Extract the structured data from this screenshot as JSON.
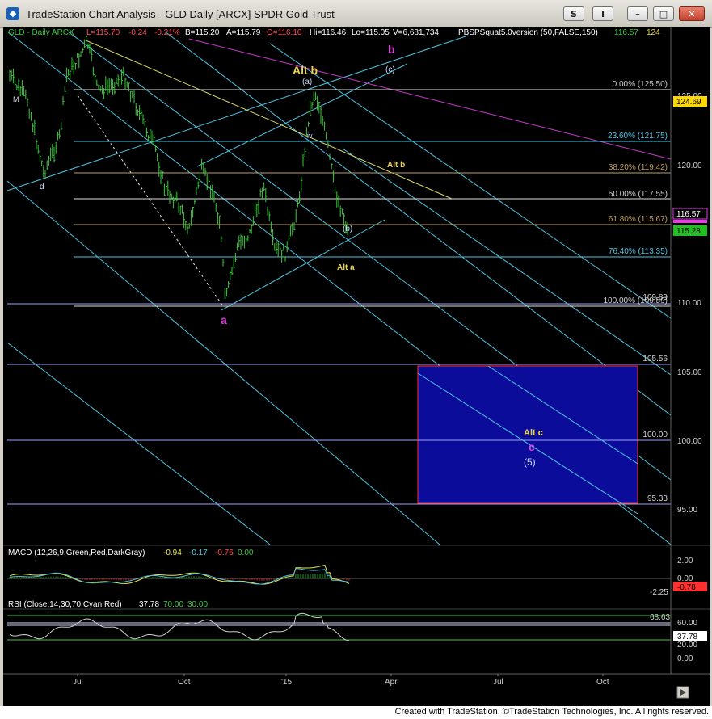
{
  "window": {
    "title": "TradeStation Chart Analysis - GLD Daily [ARCX] SPDR Gold Trust",
    "buttons": {
      "s": "S",
      "i": "I",
      "min": "–",
      "max": "□",
      "close": "✕"
    }
  },
  "header": {
    "symbol": "GLD - Daily  ARCX",
    "last": "L=115.70",
    "change": "-0.24",
    "change_pct": "-0.21%",
    "bid": "B=115.20",
    "ask": "A=115.79",
    "open": "O=116.10",
    "high": "Hi=116.46",
    "low": "Lo=115.05",
    "volume": "V=6,681,734",
    "indicator": "PBSPSquat5.0version (50,FALSE,150)",
    "ind_val1": "116.57",
    "ind_val2": "124"
  },
  "fib_levels": [
    {
      "label": "0.00% (125.50)"
    },
    {
      "label": "23.60% (121.75)"
    },
    {
      "label": "38.20% (119.42)"
    },
    {
      "label": "50.00% (117.55)"
    },
    {
      "label": "61.80% (115.67)"
    },
    {
      "label": "76.40% (113.35)"
    },
    {
      "label": "100.00% (109.59)"
    }
  ],
  "price_axis": {
    "ticks": [
      "125.00",
      "120.00",
      "110.00",
      "105.00",
      "100.00",
      "95.00"
    ]
  },
  "price_markers": {
    "m1": "124.69",
    "m2": "116.57",
    "m3": "115.28",
    "level_109": "109.89",
    "level_105": "105.56",
    "level_100": "100.00",
    "level_95": "95.33"
  },
  "wave_labels": {
    "alt_b_top": "Alt b",
    "a_paren": "(a)",
    "b_magenta": "b",
    "c_paren": "(c)",
    "d": "d",
    "alt_b_yellow": "Alt b",
    "b_paren": "(b)",
    "alt_a": "Alt a",
    "a_magenta": "a",
    "alt_c": "Alt c",
    "c_magenta": "c",
    "five": "(5)",
    "m": "M",
    "iv": "iv"
  },
  "macd": {
    "label": "MACD (12,26,9,Green,Red,DarkGray)",
    "v1": "-0.94",
    "v2": "-0.17",
    "v3": "-0.76",
    "v4": "0.00",
    "ticks": [
      "2.00",
      "0.00",
      "-2.25"
    ],
    "marker": "-0.78"
  },
  "rsi": {
    "label": "RSI (Close,14,30,70,Cyan,Red)",
    "v1": "37.78",
    "v2": "70.00",
    "v3": "30.00",
    "ticks": [
      "68.63",
      "60.00",
      "20.00",
      "0.00"
    ],
    "marker": "37.78"
  },
  "time_axis": [
    "Jul",
    "Oct",
    "'15",
    "Apr",
    "Jul",
    "Oct"
  ],
  "footer": "Created with TradeStation. ©TradeStation Technologies, Inc. All rights reserved.",
  "colors": {
    "background": "#000000",
    "cyan_line": "#4fc3e0",
    "yellow_line": "#d9d96a",
    "magenta_line": "#c838c8",
    "price_bars": "#3cc83c",
    "target_box": "#0c0c9a",
    "target_border": "#ff3030"
  }
}
